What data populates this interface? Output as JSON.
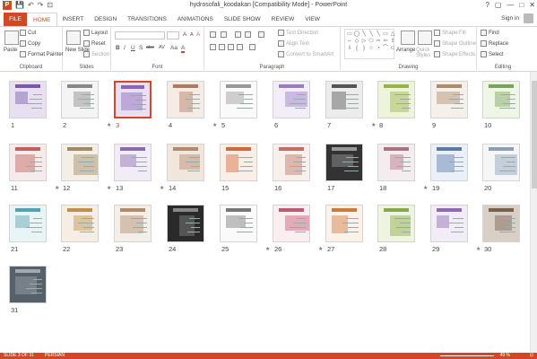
{
  "titlebar": {
    "title": "hydrosofali_koodakan [Compatibility Mode] - PowerPoint",
    "window_controls": [
      "?",
      "▢",
      "—",
      "□",
      "✕"
    ]
  },
  "quick_access": {
    "app_icon": "P",
    "save": "💾",
    "undo": "↶",
    "redo": "↷",
    "start": "⊡"
  },
  "tabs": [
    "FILE",
    "HOME",
    "INSERT",
    "DESIGN",
    "TRANSITIONS",
    "ANIMATIONS",
    "SLIDE SHOW",
    "REVIEW",
    "VIEW"
  ],
  "active_tab": "HOME",
  "signin": "Sign in",
  "ribbon": {
    "clipboard": {
      "label": "Clipboard",
      "paste": "Paste",
      "cut": "Cut",
      "copy": "Copy",
      "format_painter": "Format Painter"
    },
    "slides": {
      "label": "Slides",
      "new_slide": "New Slide",
      "layout": "Layout",
      "reset": "Reset",
      "section": "Section"
    },
    "font": {
      "label": "Font",
      "bold": "B",
      "italic": "I",
      "underline": "U",
      "strike": "S",
      "shadow": "abc",
      "spacing": "AV",
      "case": "Aa",
      "color": "A",
      "grow": "A",
      "shrink": "A",
      "clear": "A"
    },
    "paragraph": {
      "label": "Paragraph",
      "text_direction": "Text Direction",
      "align_text": "Align Text",
      "convert_smartart": "Convert to SmartArt"
    },
    "drawing": {
      "label": "Drawing",
      "arrange": "Arrange",
      "quick_styles": "Quick Styles",
      "shape_fill": "Shape Fill",
      "shape_outline": "Shape Outline",
      "shape_effects": "Shape Effects"
    },
    "editing": {
      "label": "Editing",
      "find": "Find",
      "replace": "Replace",
      "select": "Select"
    }
  },
  "slides": [
    {
      "n": "1",
      "star": false
    },
    {
      "n": "2",
      "star": true
    },
    {
      "n": "3",
      "star": false
    },
    {
      "n": "4",
      "star": true
    },
    {
      "n": "5",
      "star": false
    },
    {
      "n": "6",
      "star": false
    },
    {
      "n": "7",
      "star": true
    },
    {
      "n": "8",
      "star": false
    },
    {
      "n": "9",
      "star": false
    },
    {
      "n": "10",
      "star": false
    },
    {
      "n": "11",
      "star": true
    },
    {
      "n": "12",
      "star": true
    },
    {
      "n": "13",
      "star": true
    },
    {
      "n": "14",
      "star": false
    },
    {
      "n": "15",
      "star": false
    },
    {
      "n": "16",
      "star": false
    },
    {
      "n": "17",
      "star": false
    },
    {
      "n": "18",
      "star": true
    },
    {
      "n": "19",
      "star": false
    },
    {
      "n": "20",
      "star": false
    },
    {
      "n": "21",
      "star": false
    },
    {
      "n": "22",
      "star": false
    },
    {
      "n": "23",
      "star": false
    },
    {
      "n": "24",
      "star": false
    },
    {
      "n": "25",
      "star": true
    },
    {
      "n": "26",
      "star": true
    },
    {
      "n": "27",
      "star": false
    },
    {
      "n": "28",
      "star": false
    },
    {
      "n": "29",
      "star": true
    },
    {
      "n": "30",
      "star": false
    },
    {
      "n": "31",
      "star": false
    }
  ],
  "selected_slide": "3",
  "statusbar": {
    "slide_info": "SLIDE 3 OF 31",
    "language": "PERSIAN",
    "zoom": "49 %"
  }
}
